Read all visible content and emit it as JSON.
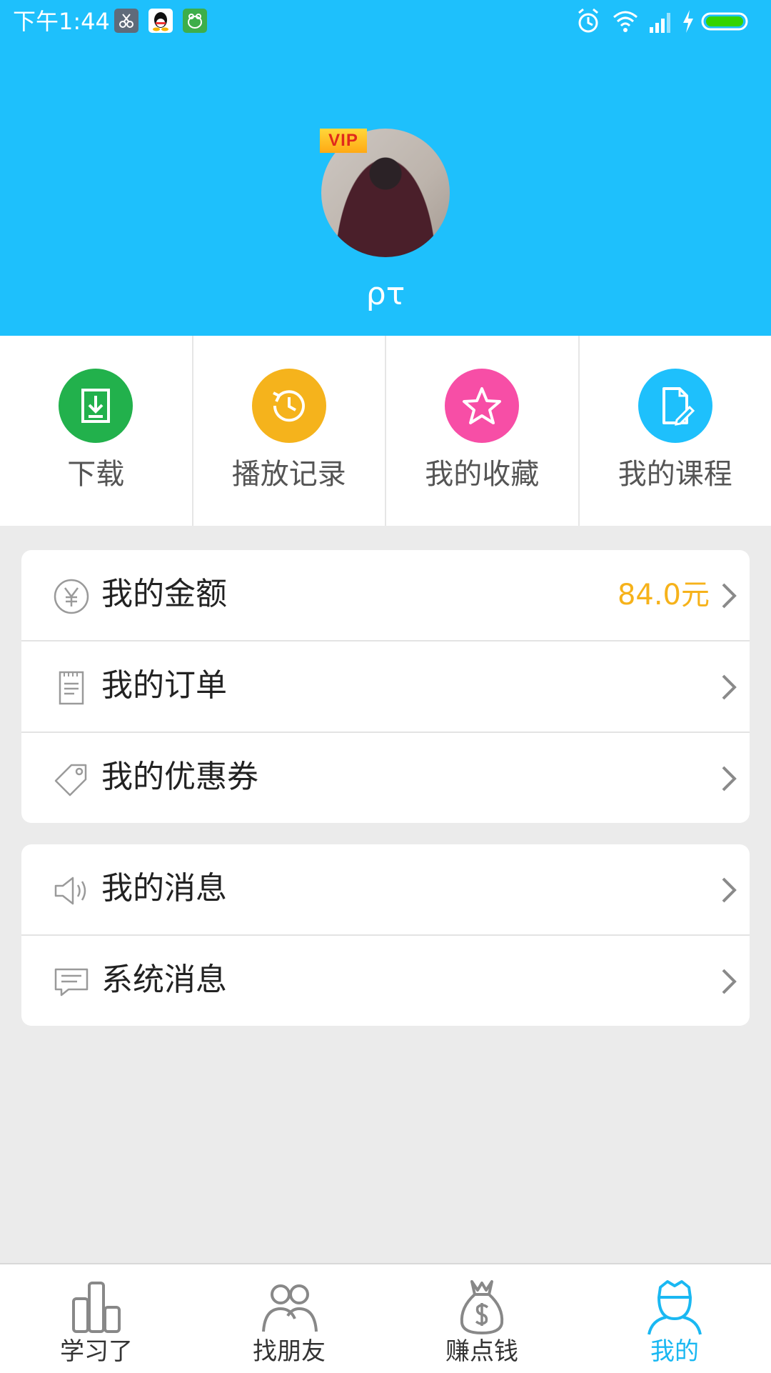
{
  "status_bar": {
    "time": "下午1:44",
    "notification_icons": [
      "scissors-app-icon",
      "qq-icon",
      "wechat-frog-icon"
    ],
    "right_icons": [
      "alarm-icon",
      "wifi-icon",
      "signal-icon",
      "charging-icon",
      "battery-icon"
    ]
  },
  "profile": {
    "vip_badge": "VIP",
    "username": "ρτ"
  },
  "quick_actions": [
    {
      "label": "下载",
      "icon": "download-icon",
      "color": "#22b14c"
    },
    {
      "label": "播放记录",
      "icon": "history-icon",
      "color": "#f5b31c"
    },
    {
      "label": "我的收藏",
      "icon": "star-icon",
      "color": "#f74ea6"
    },
    {
      "label": "我的课程",
      "icon": "course-doc-icon",
      "color": "#1ec0fc"
    }
  ],
  "account_list": [
    {
      "label": "我的金额",
      "icon": "yuan-icon",
      "value": "84.0元"
    },
    {
      "label": "我的订单",
      "icon": "order-icon",
      "value": ""
    },
    {
      "label": "我的优惠券",
      "icon": "coupon-icon",
      "value": ""
    }
  ],
  "message_list": [
    {
      "label": "我的消息",
      "icon": "speaker-icon"
    },
    {
      "label": "系统消息",
      "icon": "message-icon"
    }
  ],
  "bottom_nav": [
    {
      "label": "学习了",
      "icon": "chart-bars-icon",
      "active": false
    },
    {
      "label": "找朋友",
      "icon": "friends-icon",
      "active": false
    },
    {
      "label": "赚点钱",
      "icon": "money-bag-icon",
      "active": false
    },
    {
      "label": "我的",
      "icon": "profile-icon",
      "active": true
    }
  ],
  "colors": {
    "header_blue": "#1ec0fc",
    "amount_gold": "#f6b21a",
    "active_tab": "#1ab8f2"
  }
}
